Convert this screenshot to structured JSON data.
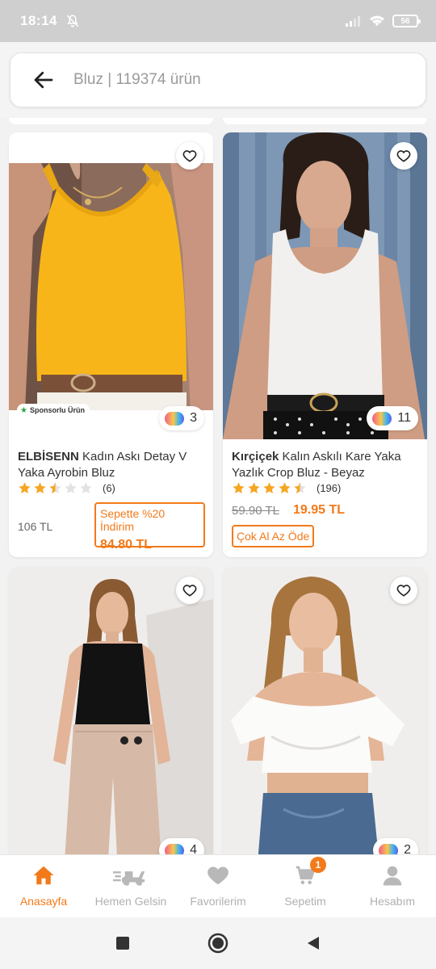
{
  "status": {
    "time": "18:14",
    "battery": "56"
  },
  "search": {
    "text": "Bluz | 119374 ürün"
  },
  "products": [
    {
      "brand": "ELBİSENN",
      "name": " Kadın Askı Detay V Yaka Ayrobin Bluz",
      "sponsored": "Sponsorlu Ürün",
      "color_count": "3",
      "rating": 2.5,
      "review_count": "(6)",
      "price": "106 TL",
      "cart_label": "Sepette %20 İndirim",
      "cart_price": "84.80 TL"
    },
    {
      "brand": "Kırçiçek",
      "name": " Kalın Askılı Kare Yaka Yazlık Crop Bluz - Beyaz",
      "color_count": "11",
      "rating": 4.5,
      "review_count": "(196)",
      "old_price": "59.90 TL",
      "new_price": "19.95 TL",
      "promo": "Çok Al Az Öde"
    },
    {
      "color_count": "4"
    },
    {
      "color_count": "2"
    }
  ],
  "bottom_nav": {
    "home": "Anasayfa",
    "express": "Hemen Gelsin",
    "favorites": "Favorilerim",
    "cart": "Sepetim",
    "cart_badge": "1",
    "account": "Hesabım"
  },
  "colors": {
    "accent": "#f27a1a",
    "inactive": "#b0b0b0",
    "star": "#f5a623"
  }
}
